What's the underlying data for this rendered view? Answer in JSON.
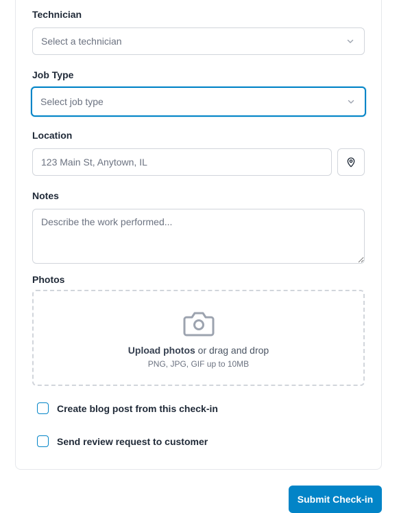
{
  "form": {
    "technician": {
      "label": "Technician",
      "placeholder": "Select a technician",
      "icon": "chevron-down-icon"
    },
    "job_type": {
      "label": "Job Type",
      "placeholder": "Select job type",
      "icon": "chevron-down-icon",
      "focused": true
    },
    "location": {
      "label": "Location",
      "value": "",
      "placeholder": "123 Main St, Anytown, IL",
      "button_icon": "map-pin-icon"
    },
    "notes": {
      "label": "Notes",
      "value": "",
      "placeholder": "Describe the work performed..."
    },
    "photos": {
      "label": "Photos",
      "icon": "camera-icon",
      "upload_text": "Upload photos",
      "drag_text": " or drag and drop",
      "hint": "PNG, JPG, GIF up to 10MB"
    },
    "options": [
      {
        "label": "Create blog post from this check-in",
        "checked": false
      },
      {
        "label": "Send review request to customer",
        "checked": false
      }
    ]
  },
  "actions": {
    "submit_label": "Submit Check-in"
  },
  "colors": {
    "accent": "#0284c7",
    "border": "#d1d5db",
    "label": "#1f2937",
    "muted": "#6b7280"
  }
}
